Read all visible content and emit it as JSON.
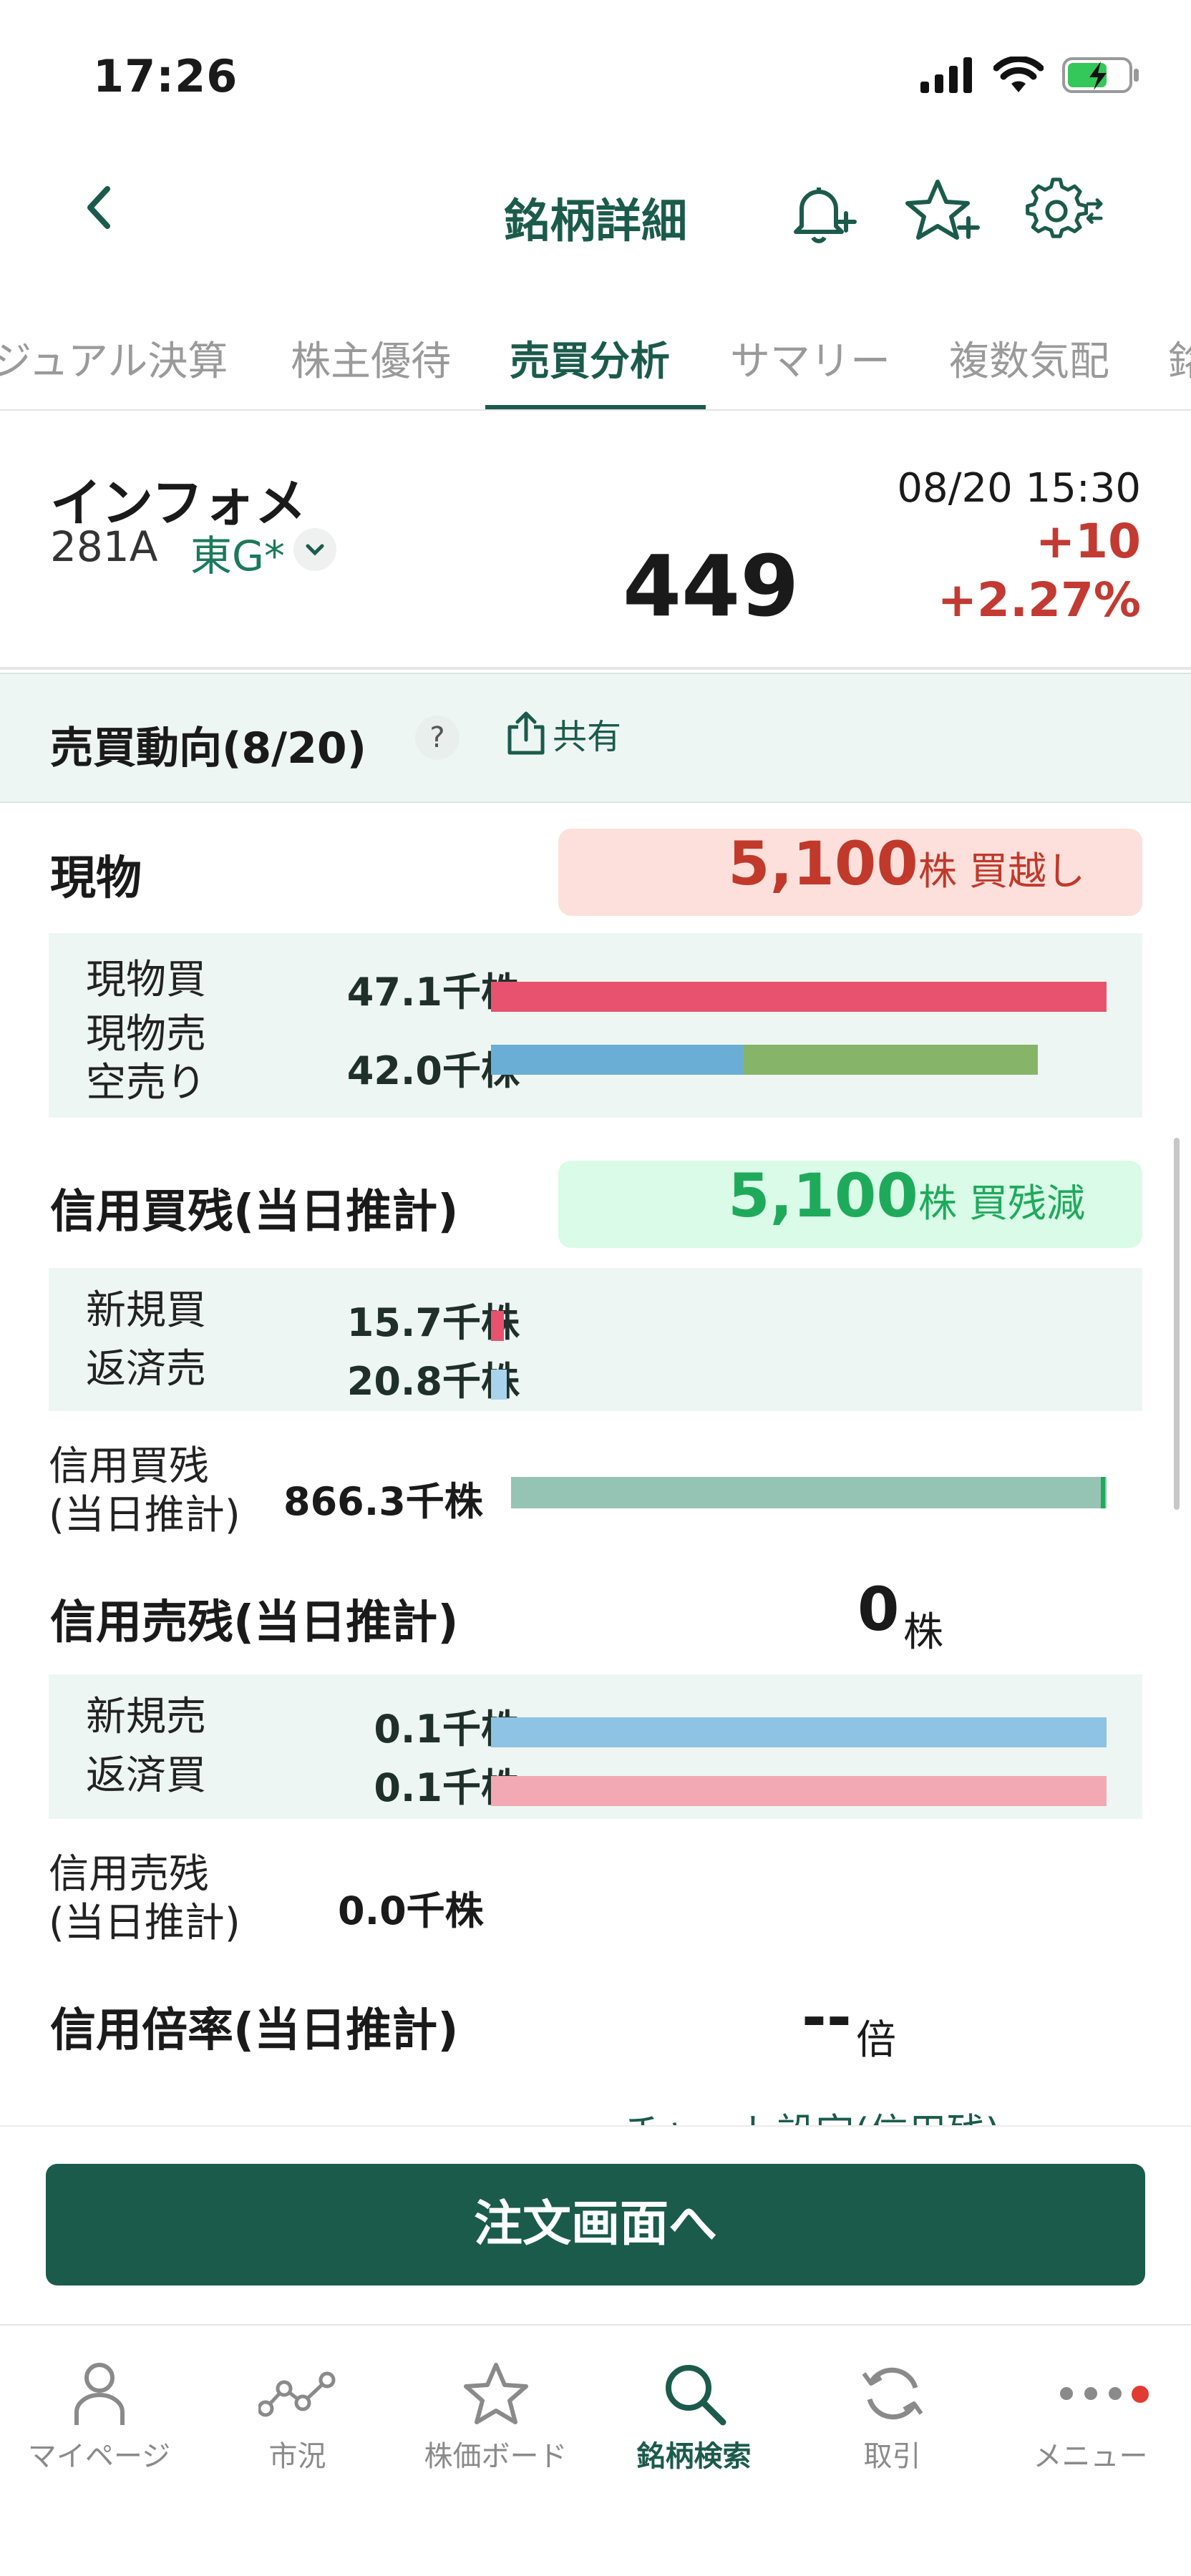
{
  "status": {
    "time": "17:26"
  },
  "header": {
    "title": "銘柄詳細"
  },
  "tabs": [
    {
      "label": "ジュアル決算",
      "active": false
    },
    {
      "label": "株主優待",
      "active": false
    },
    {
      "label": "売買分析",
      "active": true
    },
    {
      "label": "サマリー",
      "active": false
    },
    {
      "label": "複数気配",
      "active": false
    },
    {
      "label": "銘",
      "active": false
    }
  ],
  "stock": {
    "name": "インフォメ",
    "code": "281A",
    "market": "東G*",
    "price": "449",
    "datetime": "08/20 15:30",
    "change": "+10",
    "change_pct": "+2.27%"
  },
  "trend": {
    "title": "売買動向(8/20)",
    "help": "?",
    "share_label": "共有"
  },
  "cash": {
    "title": "現物",
    "net_value": "5,100",
    "net_unit": "株 買越し",
    "rows": [
      {
        "label": "現物買",
        "value": "47.1千株",
        "bar_fraction": 1.0
      },
      {
        "label": "現物売\n空売り",
        "value": "42.0千株",
        "bar_fraction_sell": 0.41,
        "bar_fraction_short": 0.48
      }
    ]
  },
  "margin_buy": {
    "title": "信用買残(当日推計)",
    "net_value": "5,100",
    "net_unit": "株 買残減",
    "rows": [
      {
        "label": "新規買",
        "value": "15.7千株"
      },
      {
        "label": "返済売",
        "value": "20.8千株"
      }
    ],
    "balance_label": "信用買残\n(当日推計)",
    "balance_value": "866.3千株"
  },
  "margin_sell": {
    "title": "信用売残(当日推計)",
    "net_value": "0",
    "net_unit": "株",
    "rows": [
      {
        "label": "新規売",
        "value": "0.1千株"
      },
      {
        "label": "返済買",
        "value": "0.1千株"
      }
    ],
    "balance_label": "信用売残\n(当日推計)",
    "balance_value": "0.0千株"
  },
  "ratio": {
    "title": "信用倍率(当日推計)",
    "value": "--",
    "unit": "倍"
  },
  "chart_link": "チャート設定(信用残)",
  "order_button": "注文画面へ",
  "bottom_nav": [
    {
      "label": "マイページ",
      "icon": "person-icon",
      "active": false
    },
    {
      "label": "市況",
      "icon": "market-icon",
      "active": false
    },
    {
      "label": "株価ボード",
      "icon": "star-icon",
      "active": false
    },
    {
      "label": "銘柄検索",
      "icon": "search-icon",
      "active": true
    },
    {
      "label": "取引",
      "icon": "refresh-icon",
      "active": false
    },
    {
      "label": "メニュー",
      "icon": "more-icon",
      "active": false
    }
  ],
  "colors": {
    "brand": "#1b5b4b",
    "up": "#c23a32",
    "buy_bar": "#e8526e",
    "sell_bar": "#6aaed6",
    "short_bar": "#86b56a",
    "balance_bar": "#95c4b4",
    "margin_sell_bar": "#8ec3e3",
    "margin_buy_return_bar": "#f3a9b3"
  }
}
